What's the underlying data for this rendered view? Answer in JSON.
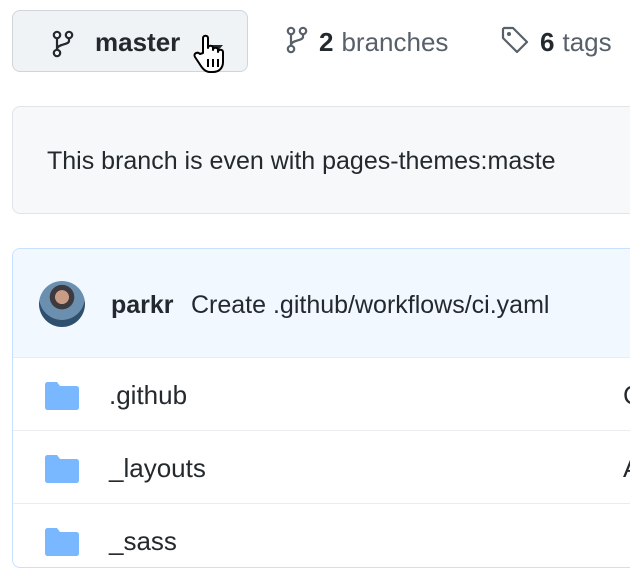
{
  "branch_select": {
    "label": "master",
    "icon": "git-branch-icon"
  },
  "branches": {
    "count": "2",
    "word": "branches",
    "icon": "git-branch-icon"
  },
  "tags": {
    "count": "6",
    "word": "tags",
    "icon": "tag-icon"
  },
  "notice": {
    "text": "This branch is even with pages-themes:maste"
  },
  "latest_commit": {
    "author": "parkr",
    "message": "Create .github/workflows/ci.yaml"
  },
  "files": [
    {
      "name": ".github",
      "rest": "C",
      "icon": "folder-icon"
    },
    {
      "name": "_layouts",
      "rest": "A",
      "icon": "folder-icon"
    },
    {
      "name": "_sass",
      "rest": "",
      "icon": "folder-icon"
    }
  ],
  "colors": {
    "folder": "#79b8ff",
    "button_bg": "#eff3f6",
    "commit_bg": "#f1f8ff"
  }
}
